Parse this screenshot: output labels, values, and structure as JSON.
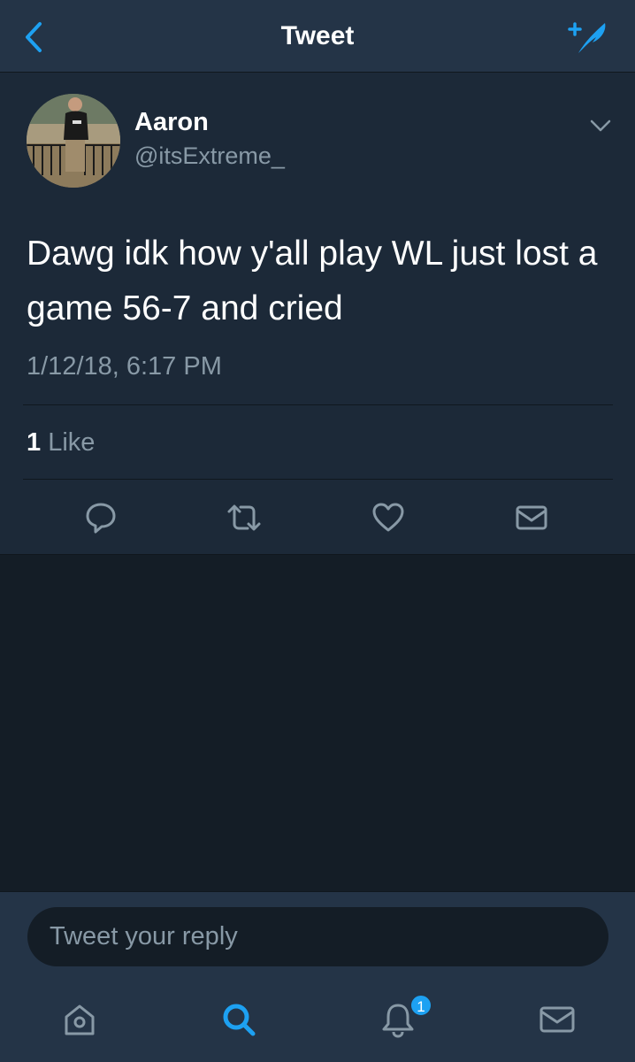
{
  "header": {
    "title": "Tweet",
    "back_icon": "chevron-left-icon",
    "compose_icon": "compose-tweet-icon"
  },
  "tweet": {
    "user": {
      "name": "Aaron",
      "handle": "@itsExtreme_"
    },
    "text": "Dawg idk how y'all play WL just lost a game 56-7 and cried",
    "timestamp": "1/12/18, 6:17 PM",
    "likes": {
      "count": "1",
      "label": "Like"
    },
    "actions": [
      "reply-icon",
      "retweet-icon",
      "like-icon",
      "direct-message-icon"
    ]
  },
  "reply": {
    "placeholder": "Tweet your reply"
  },
  "tabbar": {
    "tabs": [
      "home-icon",
      "search-icon",
      "notifications-icon",
      "messages-icon"
    ],
    "active": "search-icon",
    "notification_badge": "1"
  },
  "colors": {
    "background": "#141d26",
    "surface": "#1c2938",
    "bar": "#243447",
    "accent": "#1da1f2",
    "secondary_text": "#8899a6"
  }
}
